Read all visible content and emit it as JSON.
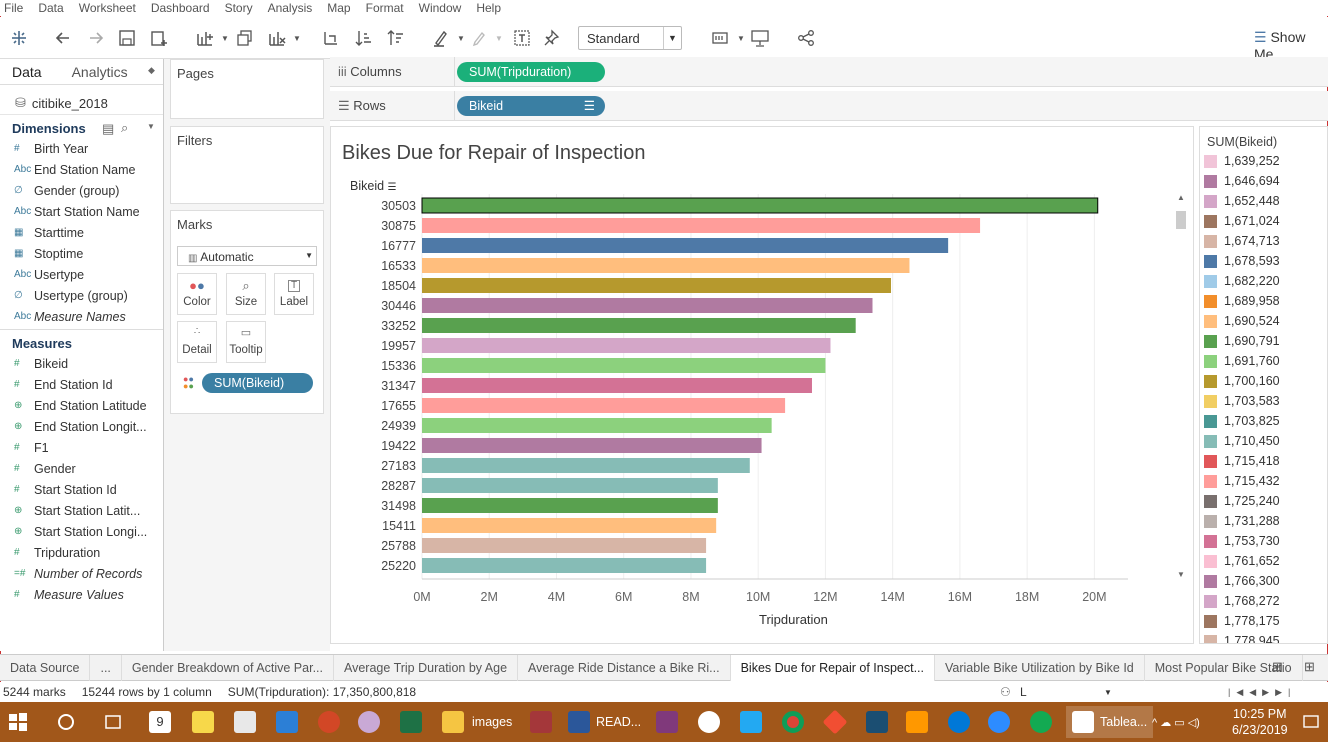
{
  "menu": [
    "File",
    "Data",
    "Worksheet",
    "Dashboard",
    "Story",
    "Analysis",
    "Map",
    "Format",
    "Window",
    "Help"
  ],
  "toolbar": {
    "view_mode": "Standard",
    "show_me": "Show Me"
  },
  "data_pane": {
    "tab_data": "Data",
    "tab_analytics": "Analytics",
    "datasource": "citibike_2018",
    "dimensions_header": "Dimensions",
    "dimensions": [
      {
        "icon": "#",
        "label": "Birth Year"
      },
      {
        "icon": "Abc",
        "label": "End Station Name"
      },
      {
        "icon": "∅",
        "label": "Gender (group)"
      },
      {
        "icon": "Abc",
        "label": "Start Station Name"
      },
      {
        "icon": "▦",
        "label": "Starttime"
      },
      {
        "icon": "▦",
        "label": "Stoptime"
      },
      {
        "icon": "Abc",
        "label": "Usertype"
      },
      {
        "icon": "∅",
        "label": "Usertype (group)"
      },
      {
        "icon": "Abc",
        "label": "Measure Names"
      }
    ],
    "measures_header": "Measures",
    "measures": [
      {
        "icon": "#",
        "label": "Bikeid"
      },
      {
        "icon": "#",
        "label": "End Station Id"
      },
      {
        "icon": "⊕",
        "label": "End Station Latitude"
      },
      {
        "icon": "⊕",
        "label": "End Station Longit..."
      },
      {
        "icon": "#",
        "label": "F1"
      },
      {
        "icon": "#",
        "label": "Gender"
      },
      {
        "icon": "#",
        "label": "Start Station Id"
      },
      {
        "icon": "⊕",
        "label": "Start Station Latit..."
      },
      {
        "icon": "⊕",
        "label": "Start Station Longi..."
      },
      {
        "icon": "#",
        "label": "Tripduration"
      },
      {
        "icon": "=#",
        "label": "Number of Records"
      },
      {
        "icon": "#",
        "label": "Measure Values"
      }
    ]
  },
  "cards": {
    "pages": "Pages",
    "filters": "Filters",
    "marks": "Marks",
    "mark_type": "Automatic",
    "color": "Color",
    "size": "Size",
    "label": "Label",
    "detail": "Detail",
    "tooltip": "Tooltip",
    "color_pill": "SUM(Bikeid)"
  },
  "shelves": {
    "columns_label": "Columns",
    "columns_pill": "SUM(Tripduration)",
    "rows_label": "Rows",
    "rows_pill": "Bikeid"
  },
  "viz": {
    "title": "Bikes Due for Repair of Inspection",
    "y_header": "Bikeid"
  },
  "chart_data": {
    "type": "bar",
    "orientation": "horizontal",
    "title": "Bikes Due for Repair of Inspection",
    "xlabel": "Tripduration",
    "ylabel": "Bikeid",
    "xlim": [
      0,
      21000000
    ],
    "xticks": [
      "0M",
      "2M",
      "4M",
      "6M",
      "8M",
      "10M",
      "12M",
      "14M",
      "16M",
      "18M",
      "20M"
    ],
    "grid": true,
    "categories": [
      "30503",
      "30875",
      "16777",
      "16533",
      "18504",
      "30446",
      "33252",
      "19957",
      "15336",
      "31347",
      "17655",
      "24939",
      "19422",
      "27183",
      "28287",
      "31498",
      "15411",
      "25788",
      "25220"
    ],
    "values": [
      20100000,
      16600000,
      15650000,
      14500000,
      13950000,
      13400000,
      12900000,
      12150000,
      12000000,
      11600000,
      10800000,
      10400000,
      10100000,
      9750000,
      8800000,
      8800000,
      8750000,
      8450000,
      8450000
    ],
    "colors": [
      "#59a14f",
      "#ff9d9a",
      "#4e79a7",
      "#ffbe7d",
      "#b6992d",
      "#b07aa1",
      "#59a14f",
      "#d4a6c8",
      "#8cd17d",
      "#d37295",
      "#ff9d9a",
      "#8cd17d",
      "#b07aa1",
      "#86bcb6",
      "#86bcb6",
      "#59a14f",
      "#ffbe7d",
      "#d7b5a6",
      "#86bcb6"
    ]
  },
  "legend": {
    "title": "SUM(Bikeid)",
    "items": [
      {
        "label": "1,639,252",
        "color": "#f1c4d8"
      },
      {
        "label": "1,646,694",
        "color": "#b07aa1"
      },
      {
        "label": "1,652,448",
        "color": "#d4a6c8"
      },
      {
        "label": "1,671,024",
        "color": "#9d7660"
      },
      {
        "label": "1,674,713",
        "color": "#d7b5a6"
      },
      {
        "label": "1,678,593",
        "color": "#4e79a7"
      },
      {
        "label": "1,682,220",
        "color": "#a0cbe8"
      },
      {
        "label": "1,689,958",
        "color": "#f28e2b"
      },
      {
        "label": "1,690,524",
        "color": "#ffbe7d"
      },
      {
        "label": "1,690,791",
        "color": "#59a14f"
      },
      {
        "label": "1,691,760",
        "color": "#8cd17d"
      },
      {
        "label": "1,700,160",
        "color": "#b6992d"
      },
      {
        "label": "1,703,583",
        "color": "#f1ce63"
      },
      {
        "label": "1,703,825",
        "color": "#499894"
      },
      {
        "label": "1,710,450",
        "color": "#86bcb6"
      },
      {
        "label": "1,715,418",
        "color": "#e15759"
      },
      {
        "label": "1,715,432",
        "color": "#ff9d9a"
      },
      {
        "label": "1,725,240",
        "color": "#79706e"
      },
      {
        "label": "1,731,288",
        "color": "#bab0ac"
      },
      {
        "label": "1,753,730",
        "color": "#d37295"
      },
      {
        "label": "1,761,652",
        "color": "#fabfd2"
      },
      {
        "label": "1,766,300",
        "color": "#b07aa1"
      },
      {
        "label": "1,768,272",
        "color": "#d4a6c8"
      },
      {
        "label": "1,778,175",
        "color": "#9d7660"
      },
      {
        "label": "1,778,945",
        "color": "#d7b5a6"
      }
    ]
  },
  "sheet_tabs": [
    "Data Source",
    "...",
    "Gender Breakdown of Active Par...",
    "Average Trip Duration by Age",
    "Average Ride Distance a Bike Ri...",
    "Bikes Due for Repair of Inspect...",
    "Variable Bike Utilization by Bike Id",
    "Most Popular Bike Statio"
  ],
  "status": {
    "marks": "5244 marks",
    "rows": "15244 rows by 1 column",
    "sum": "SUM(Tripduration): 17,350,800,818",
    "user": "L"
  },
  "taskbar": {
    "calendar_day": "9",
    "explorer": "images",
    "word": "READ...",
    "tableau": "Tablea...",
    "time": "10:25 PM",
    "date": "6/23/2019"
  }
}
